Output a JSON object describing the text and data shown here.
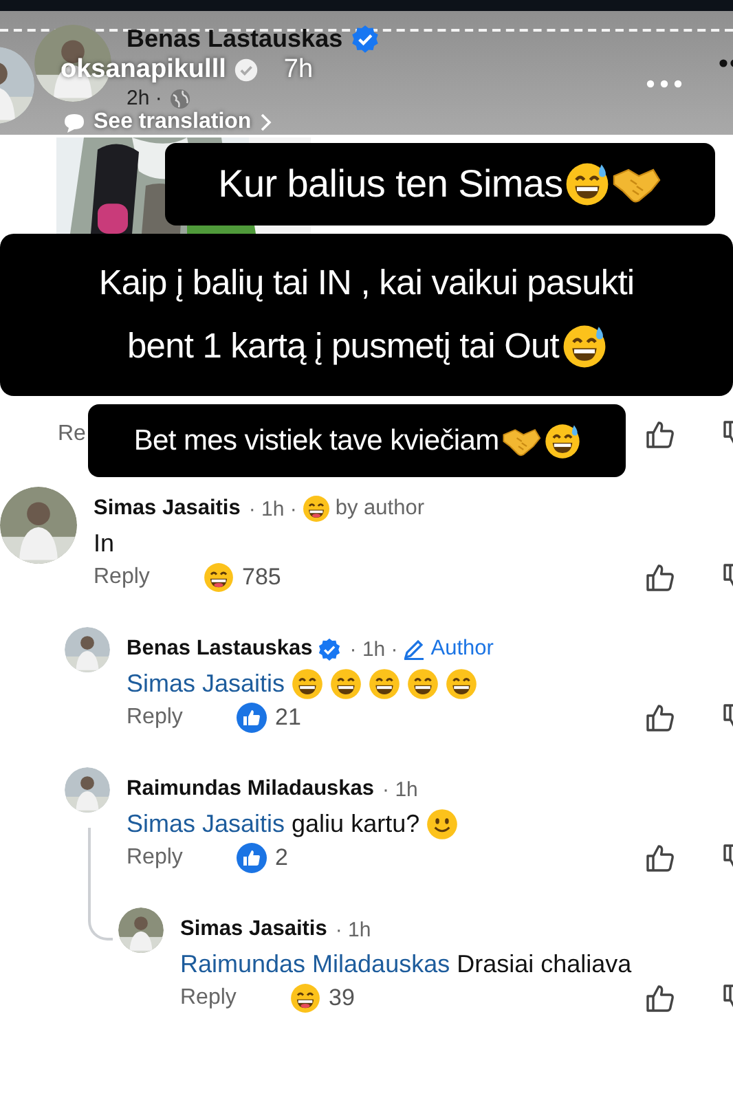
{
  "story": {
    "username": "oksanapikulll",
    "verified": true,
    "time": "7h",
    "translation_link": "See translation"
  },
  "post": {
    "author": "Benas Lastauskas",
    "verified": true,
    "time": "2h ·"
  },
  "stickers": [
    {
      "lines": [
        "Kur balius ten Simas"
      ]
    },
    {
      "lines": [
        "Kaip į balių tai IN , kai vaikui pasukti",
        "bent 1 kartą į pusmetį tai Out"
      ]
    },
    {
      "lines": [
        "Bet mes vistiek tave kviečiam"
      ]
    }
  ],
  "covered_reply": "Re",
  "comments": [
    {
      "name": "Simas Jasaitis",
      "verified": false,
      "time": "· 1h ·",
      "badge": {
        "kind": "by_author",
        "label": "by author"
      },
      "text": "In",
      "reply_label": "Reply",
      "reaction": {
        "kind": "haha",
        "count": "785"
      },
      "children": [
        {
          "name": "Benas Lastauskas",
          "verified": true,
          "time": "· 1h ·",
          "badge": {
            "kind": "author",
            "label": "Author"
          },
          "mention": "Simas Jasaitis",
          "reply_label": "Reply",
          "reaction": {
            "kind": "like",
            "count": "21"
          }
        },
        {
          "name": "Raimundas Miladauskas",
          "verified": false,
          "time": "· 1h",
          "mention": "Simas Jasaitis",
          "text": "galiu kartu?",
          "reply_label": "Reply",
          "reaction": {
            "kind": "like",
            "count": "2"
          },
          "children": [
            {
              "name": "Simas Jasaitis",
              "verified": false,
              "time": "· 1h",
              "mention": "Raimundas Miladauskas",
              "text": "Drasiai chaliava",
              "reply_label": "Reply",
              "reaction": {
                "kind": "haha",
                "count": "39"
              }
            }
          ]
        }
      ]
    }
  ]
}
